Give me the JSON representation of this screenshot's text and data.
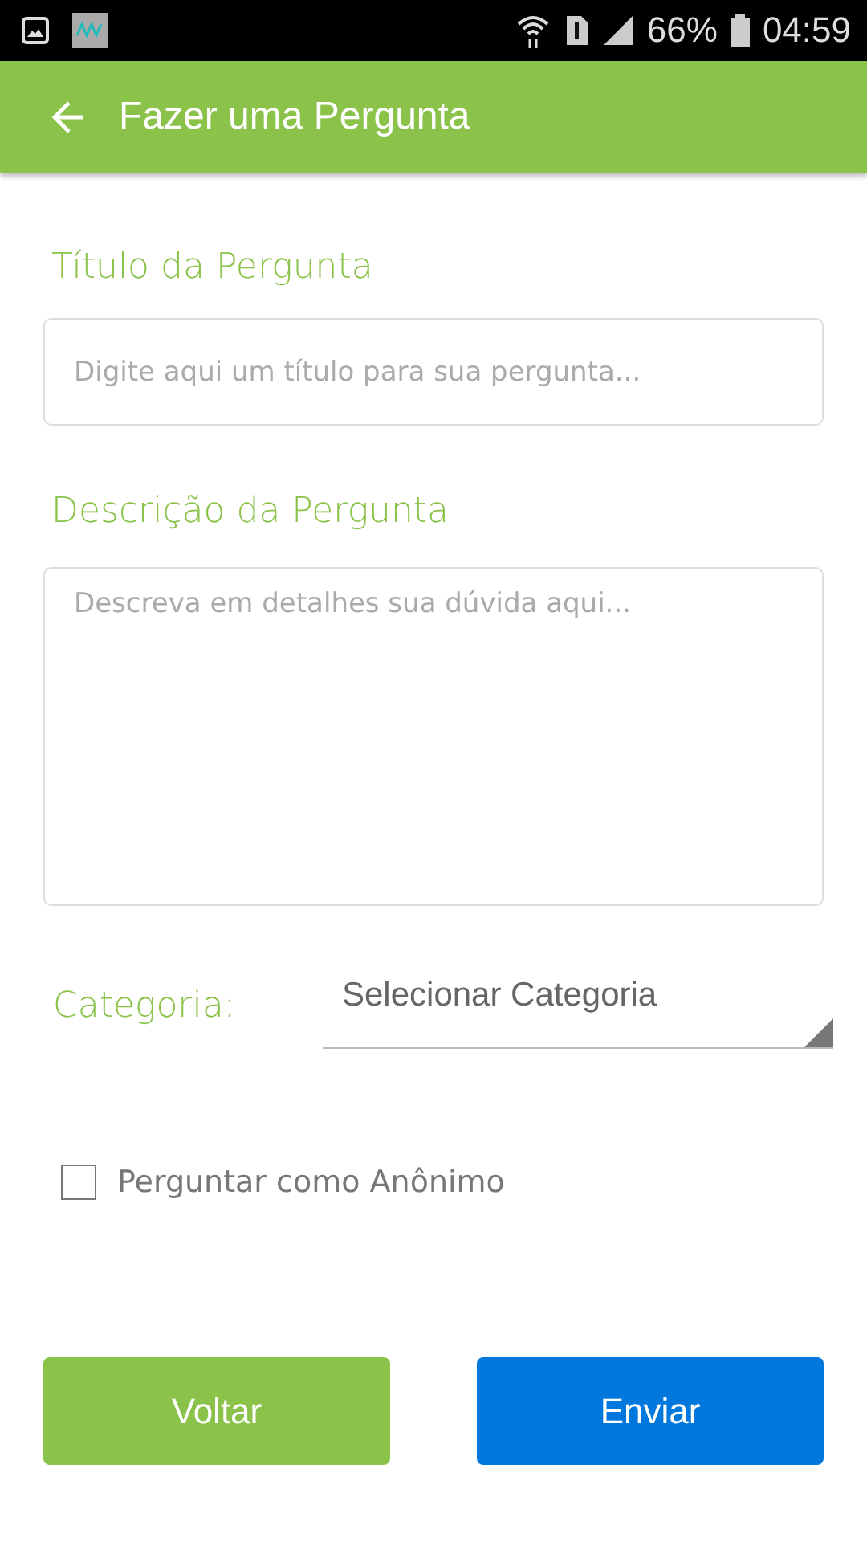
{
  "status_bar": {
    "battery_text": "66%",
    "time": "04:59"
  },
  "app_bar": {
    "title": "Fazer uma Pergunta"
  },
  "form": {
    "title_label": "Título da Pergunta",
    "title_field": {
      "placeholder": "Digite aqui um título para sua pergunta..."
    },
    "description_label": "Descrição da Pergunta",
    "description_field": {
      "placeholder": "Descreva em detalhes sua dúvida aqui..."
    },
    "category_label": "Categoria:",
    "category_dropdown": {
      "value": "Selecionar Categoria"
    },
    "anonymous": {
      "label": "Perguntar como Anônimo",
      "checked": false
    }
  },
  "buttons": [
    {
      "label": "Voltar",
      "kind": "secondary"
    },
    {
      "label": "Enviar",
      "kind": "primary"
    }
  ]
}
